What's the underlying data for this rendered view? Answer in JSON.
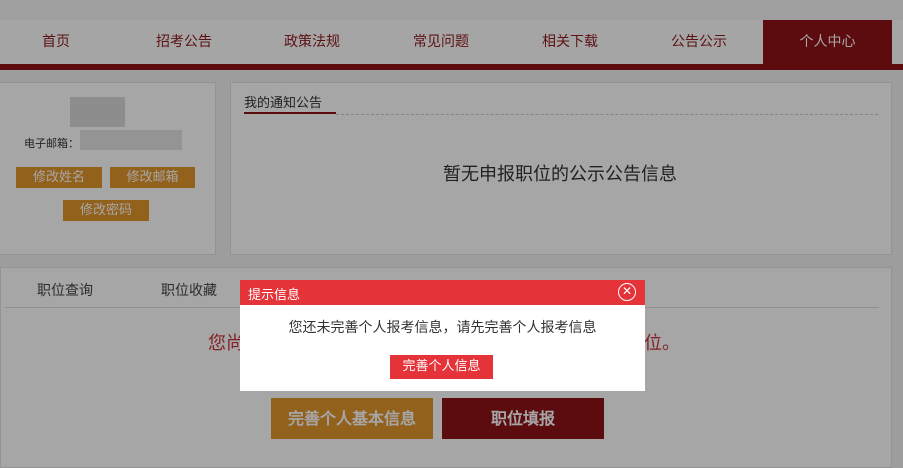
{
  "nav": {
    "items": [
      {
        "label": "首页"
      },
      {
        "label": "招考公告"
      },
      {
        "label": "政策法规"
      },
      {
        "label": "常见问题"
      },
      {
        "label": "相关下载"
      },
      {
        "label": "公告公示"
      },
      {
        "label": "个人中心",
        "active": true
      }
    ]
  },
  "profile": {
    "email_label": "电子邮箱：",
    "btn_change_name": "修改姓名",
    "btn_change_email": "修改邮箱",
    "btn_change_password": "修改密码"
  },
  "notice": {
    "title": "我的通知公告",
    "empty_message": "暂无申报职位的公示公告信息"
  },
  "tabs": [
    {
      "label": "职位查询"
    },
    {
      "label": "职位收藏"
    }
  ],
  "warning": {
    "left_fragment": "您尚",
    "right_fragment": "位。"
  },
  "actions": {
    "complete_basic_info": "完善个人基本信息",
    "position_apply": "职位填报"
  },
  "dialog": {
    "title": "提示信息",
    "close_symbol": "✕",
    "message": "您还未完善个人报考信息，请先完善个人报考信息",
    "button": "完善个人信息"
  },
  "colors": {
    "brand_dark_red": "#8e1116",
    "dialog_red": "#e5333a",
    "orange": "#e1952c"
  }
}
